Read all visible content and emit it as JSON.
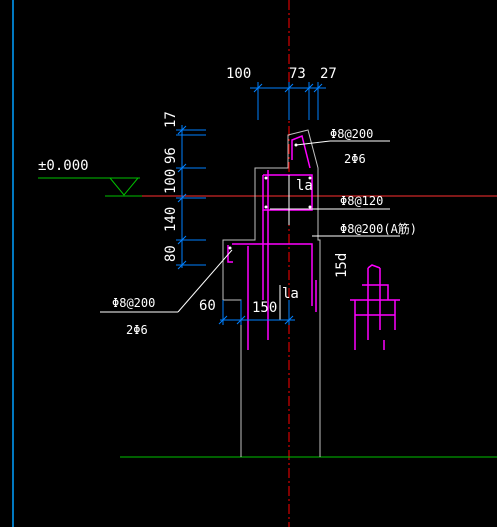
{
  "drawing": {
    "level_label": "±0.000",
    "top_dims": [
      "100",
      "73",
      "27"
    ],
    "vertical_dims": [
      "17",
      "96",
      "100",
      "140",
      "80"
    ],
    "left_dims": [
      "60",
      "150"
    ],
    "rebar_notes": {
      "top_stirrup": "Φ8@200",
      "top_bars": "2Φ6",
      "middle_stirrup": "Φ8@120",
      "lower_stirrup": "Φ8@200(Α筋)",
      "left_stirrup": "Φ8@200",
      "left_bars": "2Φ6"
    },
    "anchorage_labels": [
      "la",
      "la"
    ],
    "bend_label": "15d"
  },
  "colors": {
    "background": "#000000",
    "dimension": "#0080ff",
    "rebar": "#ff00ff",
    "axis": "#ff0000",
    "section_line": "#ff3030",
    "ground": "#00c000",
    "concrete": "#c0c0c0",
    "text": "#ffffff",
    "frame": "#00a0ff"
  }
}
